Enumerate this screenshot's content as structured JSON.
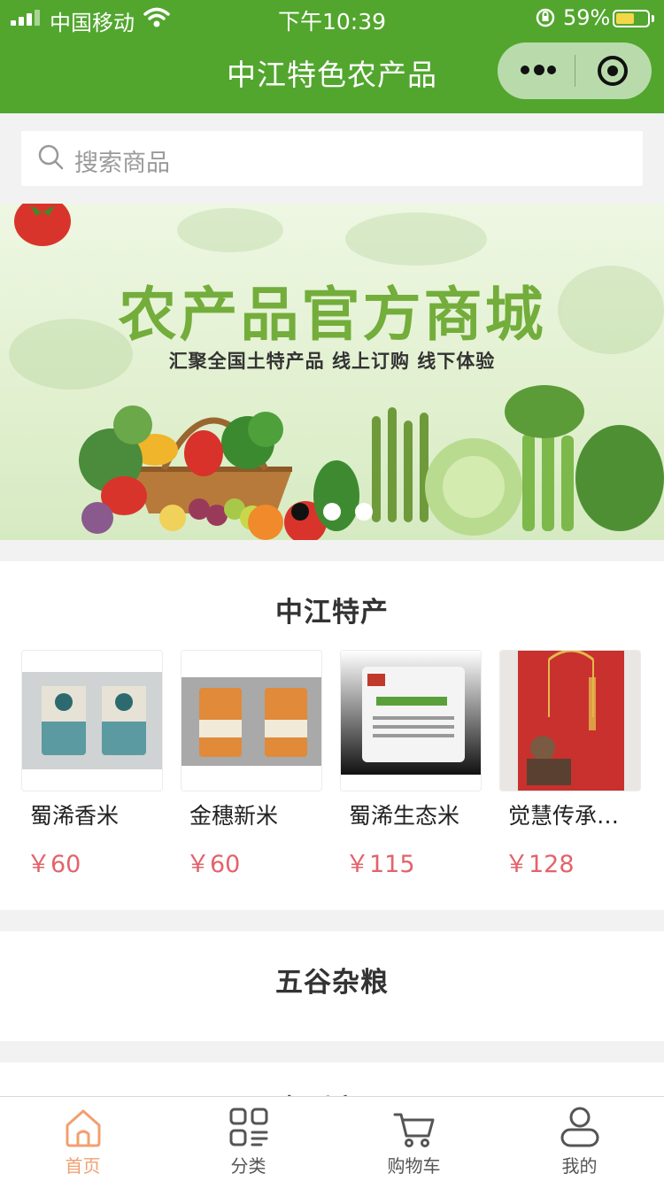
{
  "status_bar": {
    "carrier": "中国移动",
    "time": "下午10:39",
    "battery_percent": "59%",
    "battery_level": 0.59,
    "battery_color": "#f5d64a"
  },
  "nav": {
    "title": "中江特色农产品",
    "bg_color": "#52a62e",
    "capsule_icons": [
      "more-icon",
      "target-icon"
    ]
  },
  "search": {
    "placeholder": "搜索商品",
    "icon": "search-icon"
  },
  "banner": {
    "title": "农产品官方商城",
    "subtitle": "汇聚全国土特产品  线上订购  线下体验",
    "slide_count": 3,
    "active_slide": 0
  },
  "sections": [
    {
      "title": "中江特产",
      "products": [
        {
          "name": "蜀浠香米",
          "price": "￥60"
        },
        {
          "name": "金穗新米",
          "price": "￥60"
        },
        {
          "name": "蜀浠生态米",
          "price": "￥115"
        },
        {
          "name": "觉慧传承…",
          "price": "￥128"
        }
      ]
    },
    {
      "title": "五谷杂粮",
      "products": []
    },
    {
      "title": "全副商品",
      "products": []
    }
  ],
  "tabbar": {
    "items": [
      {
        "label": "首页",
        "icon": "home-icon",
        "active": true
      },
      {
        "label": "分类",
        "icon": "category-icon",
        "active": false
      },
      {
        "label": "购物车",
        "icon": "cart-icon",
        "active": false
      },
      {
        "label": "我的",
        "icon": "user-icon",
        "active": false
      }
    ],
    "active_color": "#f0a070"
  },
  "colors": {
    "price": "#e3636b",
    "banner_title": "#73ad3b"
  }
}
